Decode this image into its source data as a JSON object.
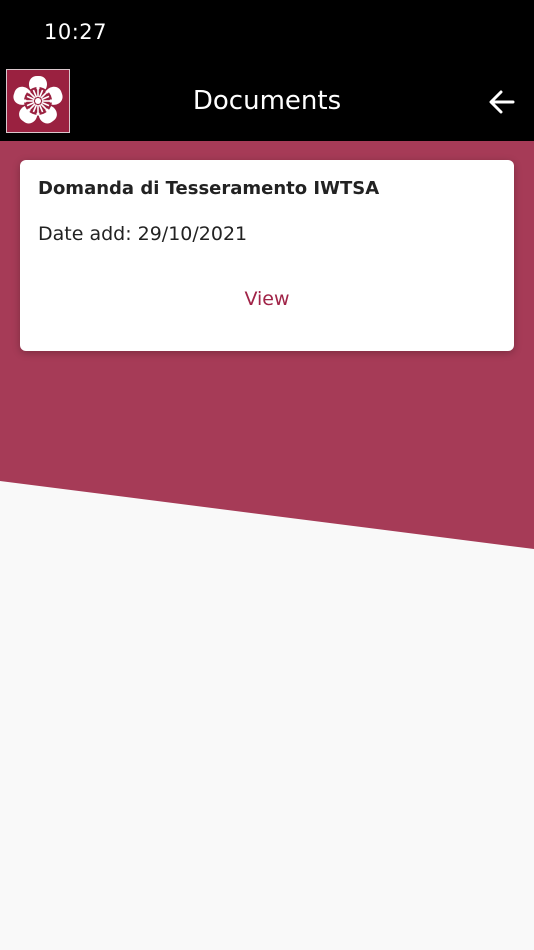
{
  "status_bar": {
    "time": "10:27"
  },
  "app_bar": {
    "title": "Documents",
    "logo_icon": "white-flower-emblem-icon",
    "back_icon": "arrow-left-icon"
  },
  "colors": {
    "accent": "#a02347",
    "hero": "#a63b57",
    "bar": "#000000",
    "background": "#f9f9f9",
    "card": "#ffffff"
  },
  "documents": [
    {
      "title": "Domanda di Tesseramento IWTSA",
      "date_label": "Date add:",
      "date_value": "29/10/2021",
      "action_label": "View"
    }
  ]
}
